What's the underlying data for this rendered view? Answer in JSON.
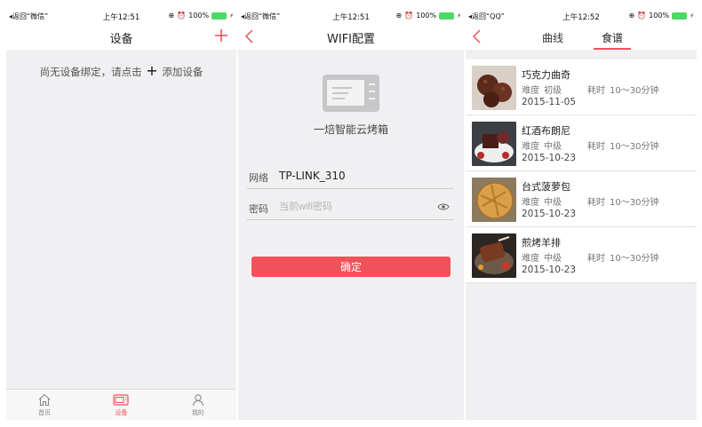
{
  "screens": [
    {
      "status": {
        "back": "◂返回“微信”",
        "time": "上午12:51",
        "battery": "100%"
      },
      "nav": {
        "title": "设备"
      },
      "empty": {
        "before": "尚无设备绑定，请点击",
        "plus": "+",
        "after": "添加设备"
      },
      "tabs": [
        {
          "label": "首页",
          "icon": "home-icon"
        },
        {
          "label": "设备",
          "icon": "oven-icon"
        },
        {
          "label": "我的",
          "icon": "person-icon"
        }
      ]
    },
    {
      "status": {
        "back": "◂返回“微信”",
        "time": "上午12:51",
        "battery": "100%"
      },
      "nav": {
        "title": "WIFI配置"
      },
      "device_name": "一焙智能云烤箱",
      "network": {
        "label": "网络",
        "value": "TP-LINK_310"
      },
      "password": {
        "label": "密码",
        "placeholder": "当前wifi密码"
      },
      "confirm_label": "确定"
    },
    {
      "status": {
        "back": "◂返回“QQ”",
        "time": "上午12:52",
        "battery": "100%"
      },
      "segments": [
        "曲线",
        "食谱"
      ],
      "recipes": [
        {
          "name": "巧克力曲奇",
          "difficulty_label": "难度",
          "difficulty": "初级",
          "time_label": "耗时",
          "time": "10～30分钟",
          "date": "2015-11-05"
        },
        {
          "name": "红酒布朗尼",
          "difficulty_label": "难度",
          "difficulty": "中级",
          "time_label": "耗时",
          "time": "10～30分钟",
          "date": "2015-10-23"
        },
        {
          "name": "台式菠萝包",
          "difficulty_label": "难度",
          "difficulty": "中级",
          "time_label": "耗时",
          "time": "10～30分钟",
          "date": "2015-10-23"
        },
        {
          "name": "煎烤羊排",
          "difficulty_label": "难度",
          "difficulty": "中级",
          "time_label": "耗时",
          "time": "10～30分钟",
          "date": "2015-10-23"
        }
      ]
    }
  ],
  "colors": {
    "accent": "#f0525a",
    "background": "#f0f0f2",
    "battery": "#4cd964"
  }
}
